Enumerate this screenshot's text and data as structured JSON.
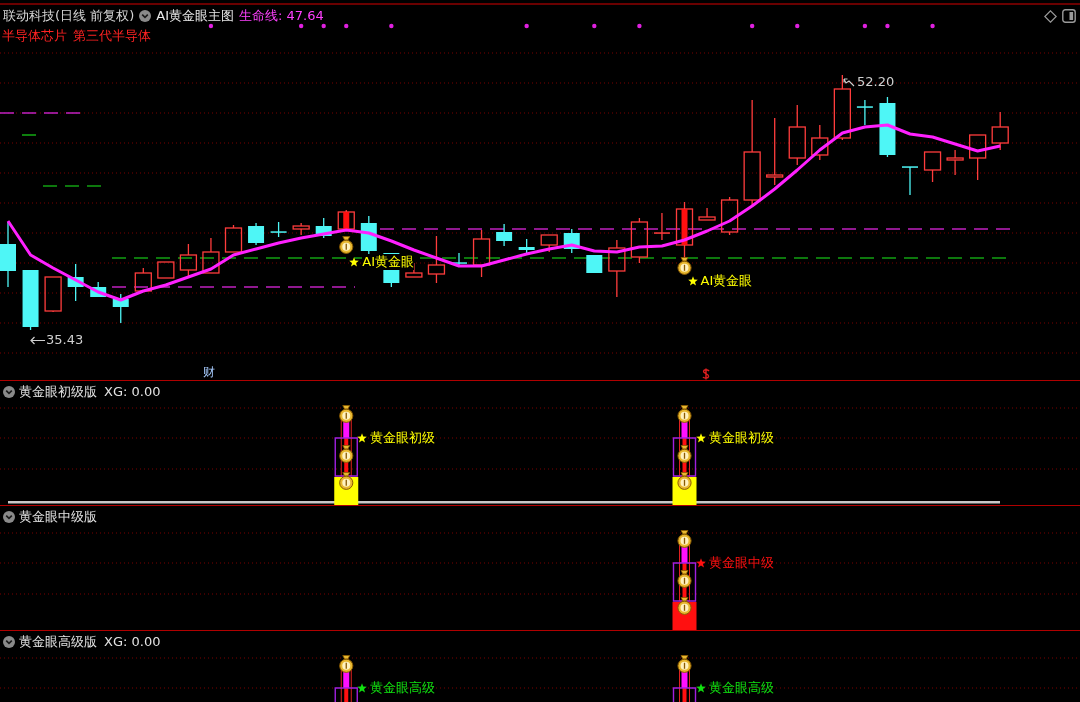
{
  "main_chart": {
    "title": "联动科技(日线 前复权)",
    "indicator": "AI黄金眼主图",
    "life_line": "生命线: 47.64",
    "concepts": [
      "半导体芯片",
      "第三代半导体"
    ],
    "high_price": "52.20",
    "low_price": "35.43",
    "news_marker": "财",
    "signals": [
      {
        "label": "AI黄金眼"
      },
      {
        "label": "AI黄金眼"
      }
    ]
  },
  "panels": [
    {
      "title": "黄金眼初级版",
      "readout": "XG: 0.00",
      "color": "#ffff00",
      "zero_line": true,
      "signals": [
        {
          "fired": true,
          "label": "黄金眼初级"
        },
        {
          "fired": true,
          "label": "黄金眼初级"
        }
      ]
    },
    {
      "title": "黄金眼中级版",
      "color": "#ff1010",
      "zero_line": false,
      "signals": [
        {
          "fired": false
        },
        {
          "fired": true,
          "label": "黄金眼中级"
        }
      ]
    },
    {
      "title": "黄金眼高级版",
      "readout": "XG: 0.00",
      "color": "#10e010",
      "signals": [
        {
          "fired": true,
          "label": "黄金眼高级"
        },
        {
          "fired": true,
          "label": "黄金眼高级"
        }
      ]
    }
  ]
}
